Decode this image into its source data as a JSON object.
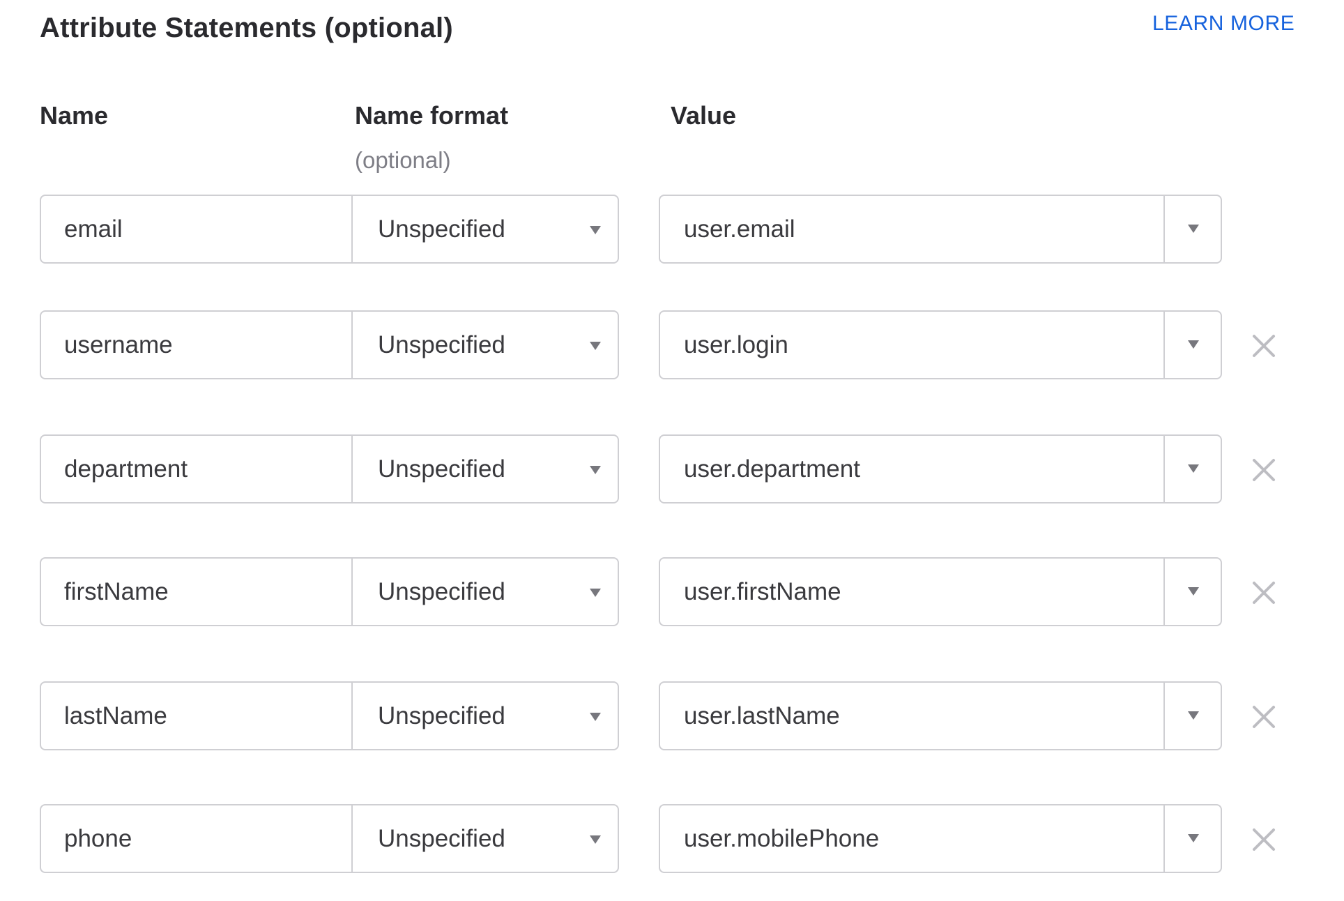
{
  "section": {
    "title": "Attribute Statements (optional)",
    "learn_more": "LEARN MORE",
    "accent_color": "#1662dd"
  },
  "columns": {
    "name": "Name",
    "name_format": "Name format",
    "name_format_sub": "(optional)",
    "value": "Value"
  },
  "rows": [
    {
      "name": "email",
      "format": "Unspecified",
      "value": "user.email",
      "removable": false
    },
    {
      "name": "username",
      "format": "Unspecified",
      "value": "user.login",
      "removable": true
    },
    {
      "name": "department",
      "format": "Unspecified",
      "value": "user.department",
      "removable": true
    },
    {
      "name": "firstName",
      "format": "Unspecified",
      "value": "user.firstName",
      "removable": true
    },
    {
      "name": "lastName",
      "format": "Unspecified",
      "value": "user.lastName",
      "removable": true
    },
    {
      "name": "phone",
      "format": "Unspecified",
      "value": "user.mobilePhone",
      "removable": true
    }
  ],
  "icons": {
    "dropdown": "caret-down-icon",
    "remove": "close-icon"
  }
}
